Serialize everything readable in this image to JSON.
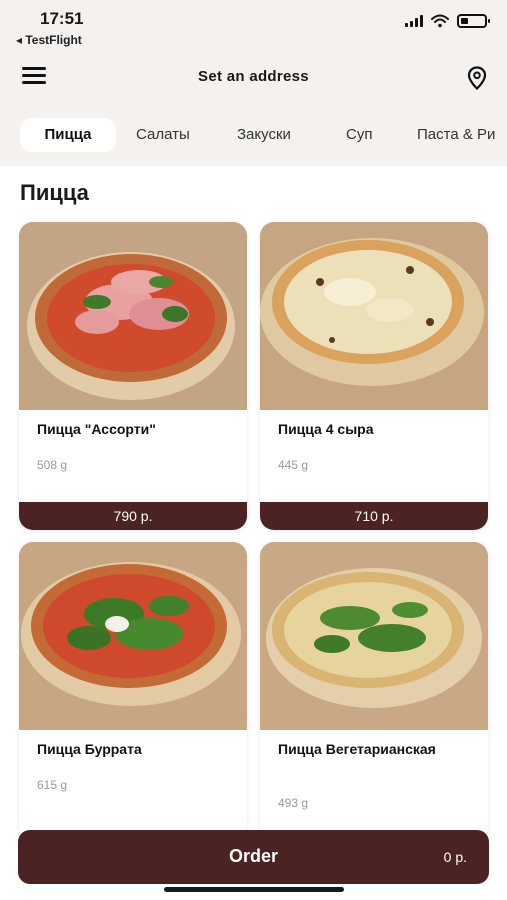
{
  "status_bar": {
    "time": "17:51",
    "back_label": "◂ TestFlight"
  },
  "header": {
    "title": "Set an address",
    "menu_icon": "hamburger-menu-icon",
    "location_icon": "location-pin-icon"
  },
  "tabs": [
    {
      "label": "Пицца",
      "active": true
    },
    {
      "label": "Салаты",
      "active": false
    },
    {
      "label": "Закуски",
      "active": false
    },
    {
      "label": "Суп",
      "active": false
    },
    {
      "label": "Паста & Ри",
      "active": false
    }
  ],
  "section": {
    "title": "Пицца"
  },
  "products": [
    {
      "name": "Пицца \"Ассорти\"",
      "weight": "508 g",
      "price": "790 р.",
      "image": "pizza-assorti-image"
    },
    {
      "name": "Пицца 4 сыра",
      "weight": "445 g",
      "price": "710 р.",
      "image": "pizza-4-cheese-image"
    },
    {
      "name": "Пицца Буррата",
      "weight": "615 g",
      "image": "pizza-burrata-image"
    },
    {
      "name": "Пицца Вегетарианская",
      "weight": "493 g",
      "image": "pizza-vegetarian-image"
    }
  ],
  "order_bar": {
    "label": "Order",
    "total": "0 р."
  },
  "colors": {
    "accent": "#4a2322",
    "background": "#f4f1ee"
  }
}
